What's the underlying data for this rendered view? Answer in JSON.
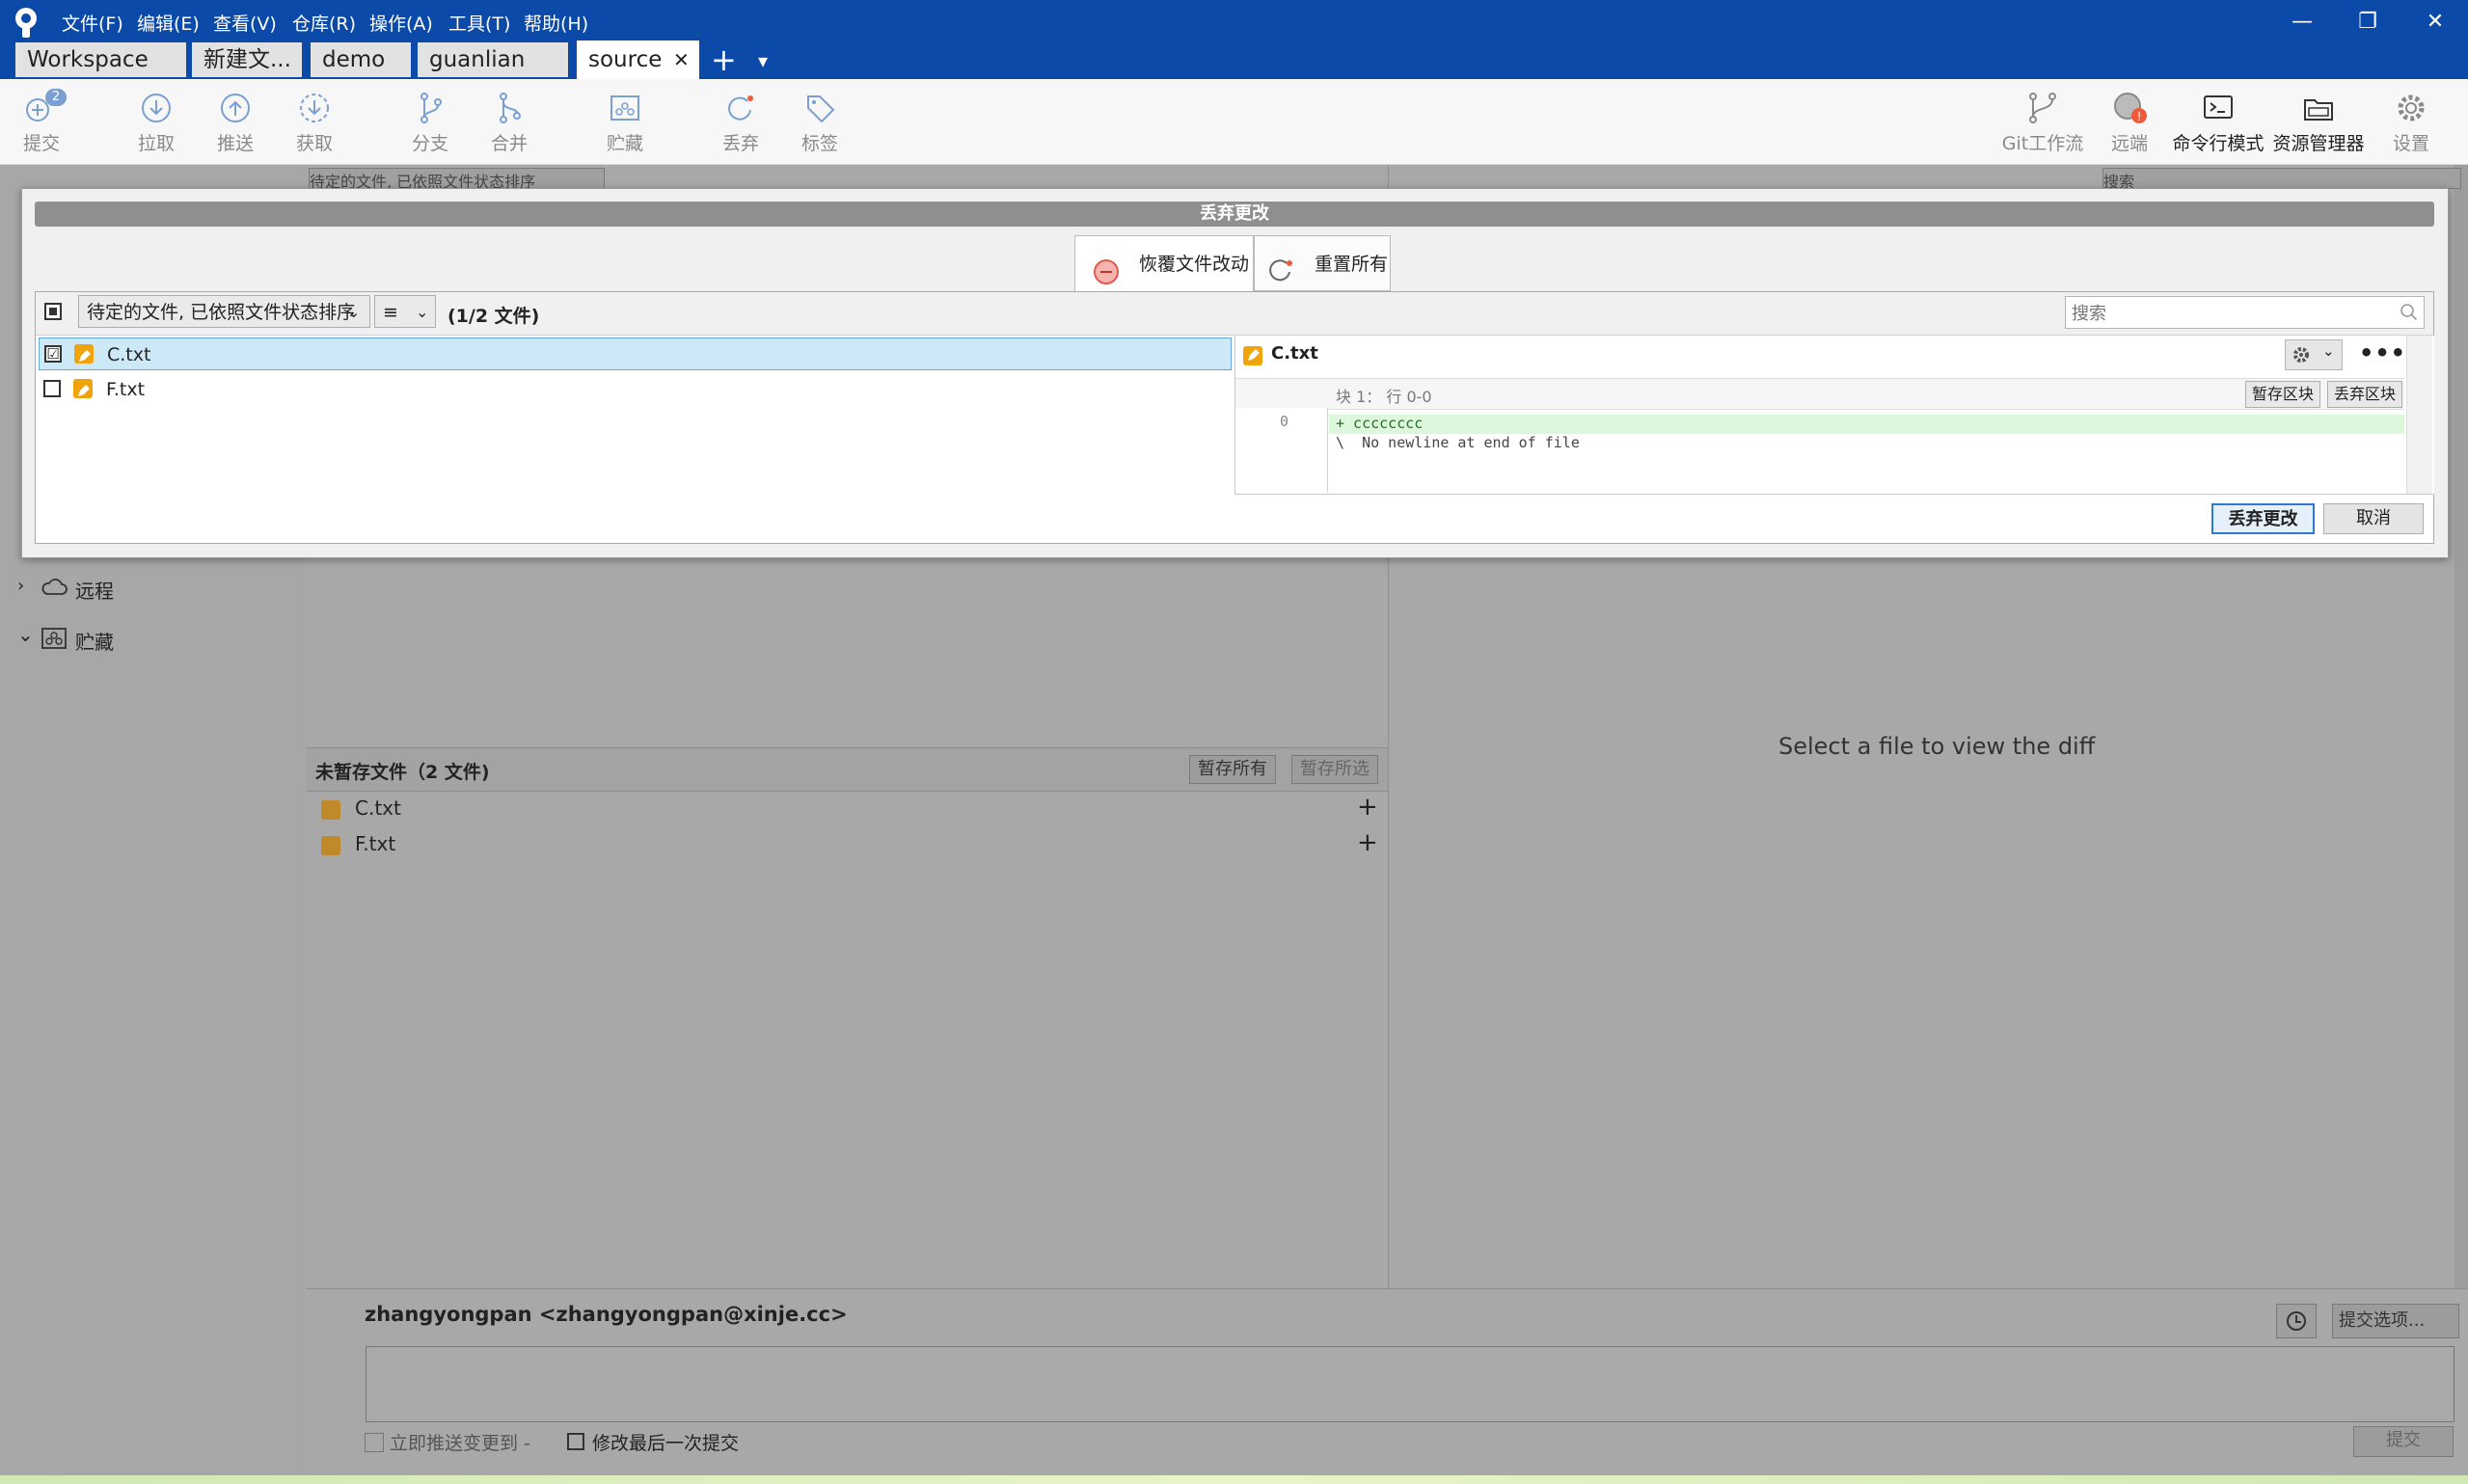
{
  "menu": [
    "文件(F)",
    "编辑(E)",
    "查看(V)",
    "仓库(R)",
    "操作(A)",
    "工具(T)",
    "帮助(H)"
  ],
  "window_buttons": {
    "minimize": "—",
    "restore": "❐",
    "close": "✕"
  },
  "tabs": [
    "Workspace",
    "新建文...",
    "demo",
    "guanlian",
    "source"
  ],
  "tab_close": "✕",
  "tab_add": "+",
  "tab_more": "▾",
  "toolbar": {
    "commit": "提交",
    "commit_badge": "2",
    "pull": "拉取",
    "push": "推送",
    "fetch": "获取",
    "branch": "分支",
    "merge": "合并",
    "stash": "贮藏",
    "discard": "丢弃",
    "tag": "标签",
    "git_flow": "Git工作流",
    "remote": "远端",
    "terminal": "命令行模式",
    "explorer": "资源管理器",
    "settings": "设置"
  },
  "dialog": {
    "title": "丢弃更改",
    "seg_revert": "恢覆文件改动",
    "seg_reset": "重置所有",
    "sort_select": "待定的文件, 已依照文件状态排序",
    "view_select": "≡",
    "count": "(1/2 文件)",
    "search_placeholder": "搜索",
    "files": [
      {
        "name": "C.txt",
        "checked": "☑"
      },
      {
        "name": "F.txt",
        "checked": ""
      }
    ],
    "diff": {
      "file": "C.txt",
      "hunk": "块 1： 行 0-0",
      "stage_hunk": "暂存区块",
      "discard_hunk": "丢弃区块",
      "line_no": "0",
      "added_line": "+ cccccccc",
      "note_line": "\\  No newline at end of file"
    },
    "discard_button": "丢弃更改",
    "cancel_button": "取消"
  },
  "background": {
    "sort_select_partial": "待定的文件, 已依照文件状态排序",
    "search_partial": "搜索",
    "sidebar": [
      {
        "label": "远程",
        "icon": "cloud-icon",
        "caret": "›"
      },
      {
        "label": "贮藏",
        "icon": "stash-icon",
        "caret": "⌄"
      }
    ],
    "unstaged_title": "未暂存文件（2 文件)",
    "stage_all": "暂存所有",
    "stage_selected": "暂存所选",
    "unstaged_files": [
      "C.txt",
      "F.txt"
    ],
    "add_icon": "+",
    "diff_placeholder": "Select a file to view the diff",
    "author": "zhangyongpan <zhangyongpan@xinje.cc>",
    "commit_options": "提交选项...",
    "push_immediately": "立即推送变更到 -",
    "amend_last": "修改最后一次提交",
    "commit_button": "提交"
  },
  "colors": {
    "titlebar": "#0b4aa8",
    "accent": "#2f7bd1",
    "modified": "#f0a30a",
    "added_line": "#ddf7dd",
    "remote_alert": "#f05a3a"
  }
}
